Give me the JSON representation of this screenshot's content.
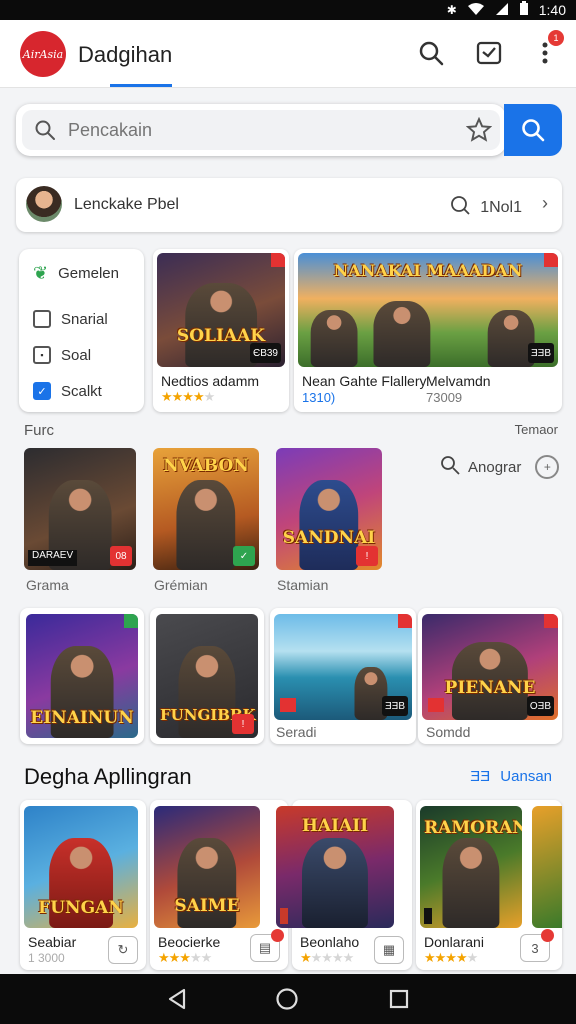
{
  "status_bar": {
    "time": "1:40"
  },
  "header": {
    "logo_text": "AirAsia",
    "title": "Dadgihan",
    "notification_count": "1"
  },
  "search": {
    "placeholder": "Pencakain"
  },
  "profile": {
    "name": "Lenckake Pbel",
    "count": "1Nol1"
  },
  "filters": [
    {
      "label": "Gemelen",
      "state": "icon"
    },
    {
      "label": "Snarial",
      "state": "unchecked"
    },
    {
      "label": "Soal",
      "state": "partial"
    },
    {
      "label": "Scalkt",
      "state": "checked"
    }
  ],
  "featured": [
    {
      "title": "Nedtios adamm",
      "art_text": "SOLIAAK",
      "badge": "ЄB39",
      "stars": 4
    },
    {
      "title": "Nean Gahte Flallery",
      "title2": "Melvamdn",
      "sub": "1310)",
      "sub2": "73009",
      "art_text": "NANAKAI MAAADAN",
      "badge": "ƎƎB"
    }
  ],
  "section_left": "Furc",
  "section_right": "Temaor",
  "row1": [
    {
      "label": "Grama",
      "art_text": "DARAEV",
      "badge": "08"
    },
    {
      "label": "Grémian",
      "art_text": "NVABON",
      "badge": "✓"
    },
    {
      "label": "Stamian",
      "art_text": "SANDNAI",
      "badge": "!"
    }
  ],
  "angle_label": "Anograr",
  "row2": [
    {
      "art_text": "EINAINUN",
      "label": ""
    },
    {
      "art_text": "FUNGIBBK",
      "label": ""
    },
    {
      "art_text": "",
      "label": "Seradi",
      "badge": "ƎƎB",
      "tag": ""
    },
    {
      "art_text": "PIENANE",
      "label": "Somdd",
      "badge": "OƎB",
      "tag": ""
    }
  ],
  "apps_section": {
    "title": "Degha Apllingran",
    "link": "Uansan",
    "link_prefix": "ƎƎ"
  },
  "apps": [
    {
      "title": "Seabiar",
      "sub": "1 3000",
      "art_text": "FUNGAN",
      "stars": 0
    },
    {
      "title": "Beocierke",
      "art_text": "SAIME",
      "stars": 3
    },
    {
      "title": "Beonlaho",
      "art_text": "HAIAII",
      "stars": 1
    },
    {
      "title": "Donlarani",
      "art_text": "RAMORAN",
      "stars": 4
    }
  ],
  "colors": {
    "accent": "#1a73e8",
    "brand": "#d7262e",
    "star": "#f4a300"
  }
}
